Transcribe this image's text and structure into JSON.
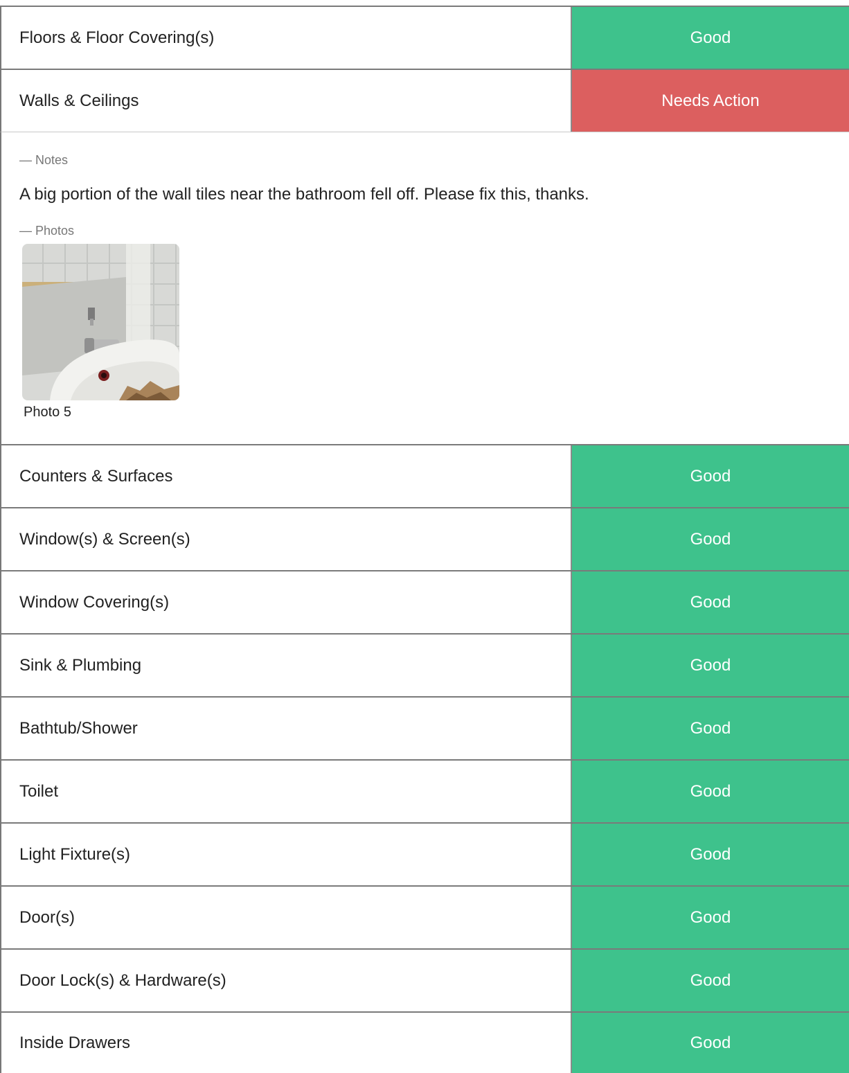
{
  "status_colors": {
    "good": "#3ec28c",
    "needs_action": "#dc5f5f"
  },
  "items_top": [
    {
      "label": "Floors & Floor Covering(s)",
      "status": "Good",
      "tone": "good"
    },
    {
      "label": "Walls & Ceilings",
      "status": "Needs Action",
      "tone": "bad"
    }
  ],
  "details": {
    "notes_label": "— Notes",
    "note_text": "A big portion of the wall tiles near the bathroom fell off. Please fix this, thanks.",
    "photos_label": "— Photos",
    "photo_caption": "Photo 5"
  },
  "items_bottom": [
    {
      "label": "Counters & Surfaces",
      "status": "Good",
      "tone": "good"
    },
    {
      "label": "Window(s) & Screen(s)",
      "status": "Good",
      "tone": "good"
    },
    {
      "label": "Window Covering(s)",
      "status": "Good",
      "tone": "good"
    },
    {
      "label": "Sink & Plumbing",
      "status": "Good",
      "tone": "good"
    },
    {
      "label": "Bathtub/Shower",
      "status": "Good",
      "tone": "good"
    },
    {
      "label": "Toilet",
      "status": "Good",
      "tone": "good"
    },
    {
      "label": "Light Fixture(s)",
      "status": "Good",
      "tone": "good"
    },
    {
      "label": "Door(s)",
      "status": "Good",
      "tone": "good"
    },
    {
      "label": "Door Lock(s) & Hardware(s)",
      "status": "Good",
      "tone": "good"
    },
    {
      "label": "Inside Drawers",
      "status": "Good",
      "tone": "good"
    }
  ]
}
